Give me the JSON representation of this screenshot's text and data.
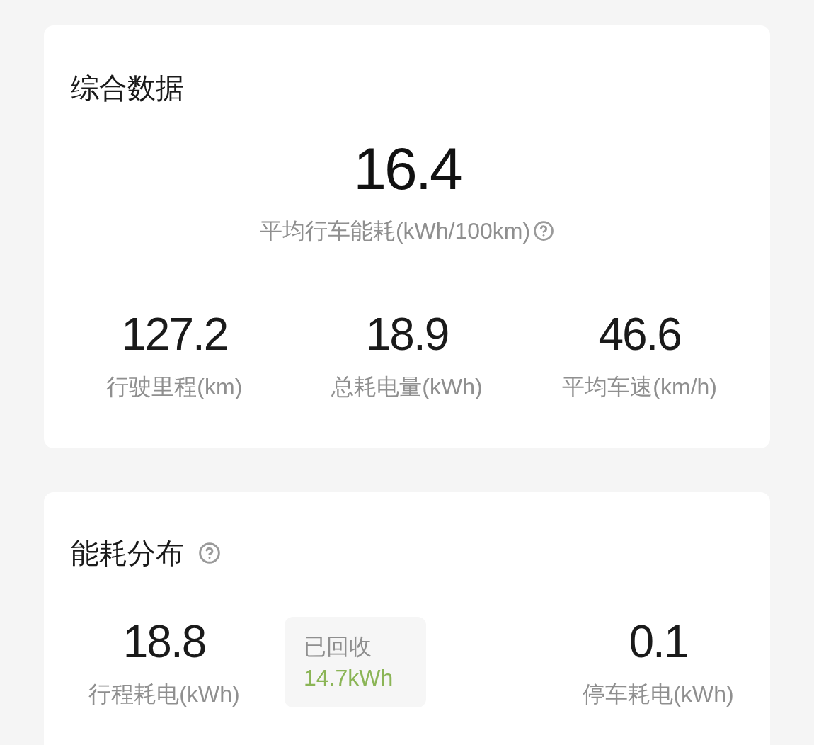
{
  "summary_card": {
    "title": "综合数据",
    "main": {
      "value": "16.4",
      "label": "平均行车能耗(kWh/100km)",
      "help": true
    },
    "stats": [
      {
        "value": "127.2",
        "label": "行驶里程(km)"
      },
      {
        "value": "18.9",
        "label": "总耗电量(kWh)"
      },
      {
        "value": "46.6",
        "label": "平均车速(km/h)"
      }
    ]
  },
  "distribution_card": {
    "title": "能耗分布",
    "help": true,
    "driving": {
      "value": "18.8",
      "label": "行程耗电(kWh)"
    },
    "recovered": {
      "label": "已回收",
      "value": "14.7kWh"
    },
    "parking": {
      "value": "0.1",
      "label": "停车耗电(kWh)"
    }
  }
}
